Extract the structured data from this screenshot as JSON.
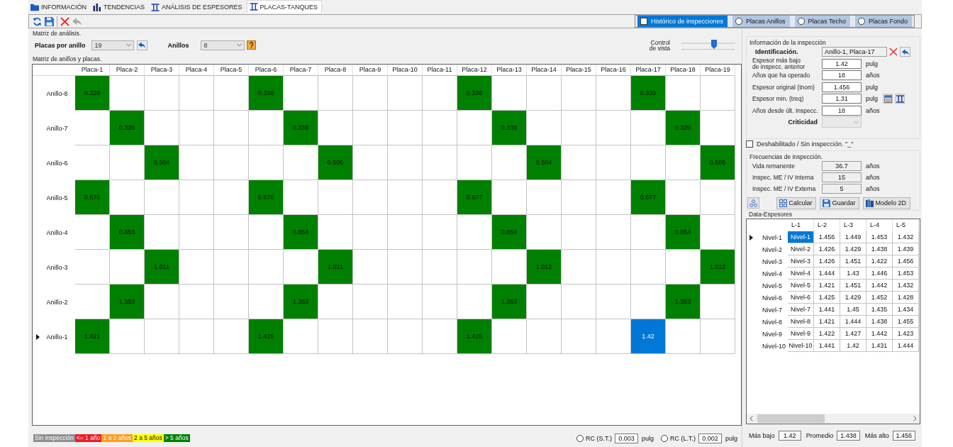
{
  "tabs": [
    {
      "kind": "folder",
      "label": "INFORMACIÓN",
      "selected": false
    },
    {
      "kind": "chart",
      "label": "TENDENCIAS",
      "selected": false
    },
    {
      "kind": "beam",
      "label": "ANÁLISIS DE ESPESORES",
      "selected": false
    },
    {
      "kind": "beam",
      "label": "PLACAS-TANQUES",
      "selected": true
    }
  ],
  "toolbar": [
    {
      "buttons": [
        {
          "kind": "refresh",
          "disabled": false
        },
        {
          "kind": "save",
          "disabled": false
        }
      ]
    },
    {
      "buttons": [
        {
          "kind": "delete",
          "disabled": false
        },
        {
          "kind": "undo",
          "disabled": true
        }
      ]
    }
  ],
  "view_options": [
    {
      "kind": "checkbox",
      "label": "Histórico de inspecciones",
      "checked": false,
      "highlighted": true
    },
    {
      "kind": "radio",
      "label": "Placas Anillos",
      "checked": false,
      "highlighted": false
    },
    {
      "kind": "radio",
      "label": "Placas Techo",
      "checked": false,
      "highlighted": false
    },
    {
      "kind": "radio",
      "label": "Placas Fondo",
      "checked": false,
      "highlighted": false
    }
  ],
  "analysis": {
    "title": "Matriz de análisis.",
    "plates_per_ring": {
      "label": "Placas por anillo",
      "value": "19"
    },
    "rings": {
      "label": "Anillos",
      "value": "8"
    },
    "view_control": {
      "label": "Control de vista",
      "level": 0.6
    }
  },
  "matrix": {
    "title": "Matriz de anillos y placas.",
    "columns": [
      "Placa-1",
      "Placa-2",
      "Placa-3",
      "Placa-4",
      "Placa-5",
      "Placa-6",
      "Placa-7",
      "Placa-8",
      "Placa-9",
      "Placa-10",
      "Placa-11",
      "Placa-12",
      "Placa-13",
      "Placa-14",
      "Placa-15",
      "Placa-16",
      "Placa-17",
      "Placa-18",
      "Placa-19"
    ],
    "rows": [
      {
        "label": "Anillo-8",
        "current": false,
        "cells": [
          {
            "value": "0.339",
            "color": "#008000",
            "selected": false
          },
          {
            "selected": false
          },
          {
            "selected": false
          },
          {
            "selected": false
          },
          {
            "selected": false
          },
          {
            "value": "0.339",
            "color": "#008000",
            "selected": false
          },
          {
            "selected": false
          },
          {
            "selected": false
          },
          {
            "selected": false
          },
          {
            "selected": false
          },
          {
            "selected": false
          },
          {
            "value": "0.339",
            "color": "#008000",
            "selected": false
          },
          {
            "selected": false
          },
          {
            "selected": false
          },
          {
            "selected": false
          },
          {
            "selected": false
          },
          {
            "value": "0.339",
            "color": "#008000",
            "selected": false
          },
          {
            "selected": false
          },
          {
            "selected": false
          }
        ]
      },
      {
        "label": "Anillo-7",
        "current": false,
        "cells": [
          {
            "selected": false
          },
          {
            "value": "0.339",
            "color": "#008000",
            "selected": false
          },
          {
            "selected": false
          },
          {
            "selected": false
          },
          {
            "selected": false
          },
          {
            "selected": false
          },
          {
            "value": "0.339",
            "color": "#008000",
            "selected": false
          },
          {
            "selected": false
          },
          {
            "selected": false
          },
          {
            "selected": false
          },
          {
            "selected": false
          },
          {
            "selected": false
          },
          {
            "value": "0.339",
            "color": "#008000",
            "selected": false
          },
          {
            "selected": false
          },
          {
            "selected": false
          },
          {
            "selected": false
          },
          {
            "selected": false
          },
          {
            "value": "0.339",
            "color": "#008000",
            "selected": false
          },
          {
            "selected": false
          }
        ]
      },
      {
        "label": "Anillo-6",
        "current": false,
        "cells": [
          {
            "selected": false
          },
          {
            "selected": false
          },
          {
            "value": "0.504",
            "color": "#008000",
            "selected": false
          },
          {
            "selected": false
          },
          {
            "selected": false
          },
          {
            "selected": false
          },
          {
            "selected": false
          },
          {
            "value": "0.505",
            "color": "#008000",
            "selected": false
          },
          {
            "selected": false
          },
          {
            "selected": false
          },
          {
            "selected": false
          },
          {
            "selected": false
          },
          {
            "selected": false
          },
          {
            "value": "0.504",
            "color": "#008000",
            "selected": false
          },
          {
            "selected": false
          },
          {
            "selected": false
          },
          {
            "selected": false
          },
          {
            "selected": false
          },
          {
            "value": "0.505",
            "color": "#008000",
            "selected": false
          }
        ]
      },
      {
        "label": "Anillo-5",
        "current": false,
        "cells": [
          {
            "value": "0.676",
            "color": "#008000",
            "selected": false
          },
          {
            "selected": false
          },
          {
            "selected": false
          },
          {
            "selected": false
          },
          {
            "selected": false
          },
          {
            "value": "0.676",
            "color": "#008000",
            "selected": false
          },
          {
            "selected": false
          },
          {
            "selected": false
          },
          {
            "selected": false
          },
          {
            "selected": false
          },
          {
            "selected": false
          },
          {
            "value": "0.677",
            "color": "#008000",
            "selected": false
          },
          {
            "selected": false
          },
          {
            "selected": false
          },
          {
            "selected": false
          },
          {
            "selected": false
          },
          {
            "value": "0.677",
            "color": "#008000",
            "selected": false
          },
          {
            "selected": false
          },
          {
            "selected": false
          }
        ]
      },
      {
        "label": "Anillo-4",
        "current": false,
        "cells": [
          {
            "selected": false
          },
          {
            "value": "0.853",
            "color": "#008000",
            "selected": false
          },
          {
            "selected": false
          },
          {
            "selected": false
          },
          {
            "selected": false
          },
          {
            "selected": false
          },
          {
            "value": "0.854",
            "color": "#008000",
            "selected": false
          },
          {
            "selected": false
          },
          {
            "selected": false
          },
          {
            "selected": false
          },
          {
            "selected": false
          },
          {
            "selected": false
          },
          {
            "value": "0.854",
            "color": "#008000",
            "selected": false
          },
          {
            "selected": false
          },
          {
            "selected": false
          },
          {
            "selected": false
          },
          {
            "selected": false
          },
          {
            "value": "0.854",
            "color": "#008000",
            "selected": false
          },
          {
            "selected": false
          }
        ]
      },
      {
        "label": "Anillo-3",
        "current": false,
        "cells": [
          {
            "selected": false
          },
          {
            "selected": false
          },
          {
            "value": "1.011",
            "color": "#008000",
            "selected": false
          },
          {
            "selected": false
          },
          {
            "selected": false
          },
          {
            "selected": false
          },
          {
            "selected": false
          },
          {
            "value": "1.011",
            "color": "#008000",
            "selected": false
          },
          {
            "selected": false
          },
          {
            "selected": false
          },
          {
            "selected": false
          },
          {
            "selected": false
          },
          {
            "selected": false
          },
          {
            "value": "1.012",
            "color": "#008000",
            "selected": false
          },
          {
            "selected": false
          },
          {
            "selected": false
          },
          {
            "selected": false
          },
          {
            "selected": false
          },
          {
            "value": "1.012",
            "color": "#008000",
            "selected": false
          }
        ]
      },
      {
        "label": "Anillo-2",
        "current": false,
        "cells": [
          {
            "selected": false
          },
          {
            "value": "1.353",
            "color": "#008000",
            "selected": false
          },
          {
            "selected": false
          },
          {
            "selected": false
          },
          {
            "selected": false
          },
          {
            "selected": false
          },
          {
            "value": "1.353",
            "color": "#008000",
            "selected": false
          },
          {
            "selected": false
          },
          {
            "selected": false
          },
          {
            "selected": false
          },
          {
            "selected": false
          },
          {
            "selected": false
          },
          {
            "value": "1.353",
            "color": "#008000",
            "selected": false
          },
          {
            "selected": false
          },
          {
            "selected": false
          },
          {
            "selected": false
          },
          {
            "selected": false
          },
          {
            "value": "1.353",
            "color": "#008000",
            "selected": false
          },
          {
            "selected": false
          }
        ]
      },
      {
        "label": "Anillo-1",
        "current": true,
        "cells": [
          {
            "value": "1.421",
            "color": "#008000",
            "selected": false
          },
          {
            "selected": false
          },
          {
            "selected": false
          },
          {
            "selected": false
          },
          {
            "selected": false
          },
          {
            "value": "1.425",
            "color": "#008000",
            "selected": false
          },
          {
            "selected": false
          },
          {
            "selected": false
          },
          {
            "selected": false
          },
          {
            "selected": false
          },
          {
            "selected": false
          },
          {
            "value": "1.425",
            "color": "#008000",
            "selected": false
          },
          {
            "selected": false
          },
          {
            "selected": false
          },
          {
            "selected": false
          },
          {
            "selected": false
          },
          {
            "value": "1.42",
            "selected": true
          },
          {
            "selected": false
          },
          {
            "selected": false
          }
        ]
      }
    ]
  },
  "legend": [
    {
      "label": "Sin inspección",
      "color": "#909090"
    },
    {
      "label": "<= 1 año",
      "color": "#ee1c25"
    },
    {
      "label": "1 a 2 años",
      "color": "#ff9e1b"
    },
    {
      "label": "2 a 5 años",
      "color": "#ffff00"
    },
    {
      "label": "> 5 años",
      "color": "#008000"
    }
  ],
  "rc": [
    {
      "label": "RC (S.T.)",
      "checked": false,
      "value": "0.003",
      "unit": "pulg"
    },
    {
      "label": "RC (L.T.)",
      "checked": false,
      "value": "0.002",
      "unit": "pulg"
    }
  ],
  "inspection": {
    "title": "Información de la inspección",
    "identification": {
      "label": "Identificación.",
      "value": "Anillo-1, Placa-17"
    },
    "fields": [
      {
        "label": "Espesor más bajo\nde inspecc. anterior",
        "value": "1.42",
        "unit": "pulg"
      },
      {
        "label": "Años que ha operado",
        "value": "18",
        "unit": "años"
      },
      {
        "label": "Espesor original (tnom)",
        "value": "1.456",
        "unit": "pulg"
      },
      {
        "label": "Espesor min. (treq)",
        "value": "1.31",
        "unit": "pulg",
        "tools": [
          {
            "kind": "table"
          },
          {
            "kind": "beam"
          }
        ]
      },
      {
        "label": "Años desde últ. Inspecc.",
        "value": "18",
        "unit": "años"
      }
    ],
    "criticality": {
      "label": "Criticidad",
      "disabled": true
    }
  },
  "disabled_checkbox": {
    "label": "Deshabilitado / Sin inspección. \"_\"",
    "checked": false
  },
  "frequencies": {
    "title": "Frecuencias de inspección.",
    "fields": [
      {
        "label": "Vida remanente",
        "value": "36.7",
        "unit": "años"
      },
      {
        "label": "Inspec. ME / IV Interna",
        "value": "15",
        "unit": "años"
      },
      {
        "label": "Inspec. ME / IV Externa",
        "value": "5",
        "unit": "años"
      }
    ],
    "buttons": [
      {
        "kind": "nodes"
      },
      {
        "kind": "grid",
        "label": "Calcular"
      },
      {
        "kind": "save",
        "label": "Guardar"
      },
      {
        "kind": "book",
        "label": "Modelo 2D"
      }
    ]
  },
  "data_table": {
    "title": "Data-Espesores",
    "columns": [
      "L-1",
      "L-2",
      "L-3",
      "L-4",
      "L-5"
    ],
    "rows": [
      {
        "label": "Nivel-1",
        "current": true,
        "cells": [
          {
            "value": "Nivel-1",
            "selected": true
          },
          {
            "value": "1.456",
            "selected": false
          },
          {
            "value": "1.449",
            "selected": false
          },
          {
            "value": "1.453",
            "selected": false
          },
          {
            "value": "1.432",
            "selected": false
          }
        ]
      },
      {
        "label": "Nivel-2",
        "current": false,
        "cells": [
          {
            "value": "Nivel-2",
            "selected": false
          },
          {
            "value": "1.426",
            "selected": false
          },
          {
            "value": "1.429",
            "selected": false
          },
          {
            "value": "1.438",
            "selected": false
          },
          {
            "value": "1.439",
            "selected": false
          }
        ]
      },
      {
        "label": "Nivel-3",
        "current": false,
        "cells": [
          {
            "value": "Nivel-3",
            "selected": false
          },
          {
            "value": "1.426",
            "selected": false
          },
          {
            "value": "1.451",
            "selected": false
          },
          {
            "value": "1.422",
            "selected": false
          },
          {
            "value": "1.456",
            "selected": false
          }
        ]
      },
      {
        "label": "Nivel-4",
        "current": false,
        "cells": [
          {
            "value": "Nivel-4",
            "selected": false
          },
          {
            "value": "1.444",
            "selected": false
          },
          {
            "value": "1.43",
            "selected": false
          },
          {
            "value": "1.446",
            "selected": false
          },
          {
            "value": "1.453",
            "selected": false
          }
        ]
      },
      {
        "label": "Nivel-5",
        "current": false,
        "cells": [
          {
            "value": "Nivel-5",
            "selected": false
          },
          {
            "value": "1.421",
            "selected": false
          },
          {
            "value": "1.451",
            "selected": false
          },
          {
            "value": "1.442",
            "selected": false
          },
          {
            "value": "1.432",
            "selected": false
          }
        ]
      },
      {
        "label": "Nivel-6",
        "current": false,
        "cells": [
          {
            "value": "Nivel-6",
            "selected": false
          },
          {
            "value": "1.425",
            "selected": false
          },
          {
            "value": "1.429",
            "selected": false
          },
          {
            "value": "1.452",
            "selected": false
          },
          {
            "value": "1.428",
            "selected": false
          }
        ]
      },
      {
        "label": "Nivel-7",
        "current": false,
        "cells": [
          {
            "value": "Nivel-7",
            "selected": false
          },
          {
            "value": "1.441",
            "selected": false
          },
          {
            "value": "1.45",
            "selected": false
          },
          {
            "value": "1.435",
            "selected": false
          },
          {
            "value": "1.434",
            "selected": false
          }
        ]
      },
      {
        "label": "Nivel-8",
        "current": false,
        "cells": [
          {
            "value": "Nivel-8",
            "selected": false
          },
          {
            "value": "1.421",
            "selected": false
          },
          {
            "value": "1.444",
            "selected": false
          },
          {
            "value": "1.438",
            "selected": false
          },
          {
            "value": "1.455",
            "selected": false
          }
        ]
      },
      {
        "label": "Nivel-9",
        "current": false,
        "cells": [
          {
            "value": "Nivel-9",
            "selected": false
          },
          {
            "value": "1.422",
            "selected": false
          },
          {
            "value": "1.427",
            "selected": false
          },
          {
            "value": "1.442",
            "selected": false
          },
          {
            "value": "1.423",
            "selected": false
          }
        ]
      },
      {
        "label": "Nivel-10",
        "current": false,
        "cells": [
          {
            "value": "Nivel-10",
            "selected": false
          },
          {
            "value": "1.441",
            "selected": false
          },
          {
            "value": "1.42",
            "selected": false
          },
          {
            "value": "1.431",
            "selected": false
          },
          {
            "value": "1.444",
            "selected": false
          }
        ]
      }
    ]
  },
  "stats": [
    {
      "label": "Más bajo",
      "value": "1.42"
    },
    {
      "label": "Promedio",
      "value": "1.438"
    },
    {
      "label": "Más alto",
      "value": "1.456"
    }
  ]
}
